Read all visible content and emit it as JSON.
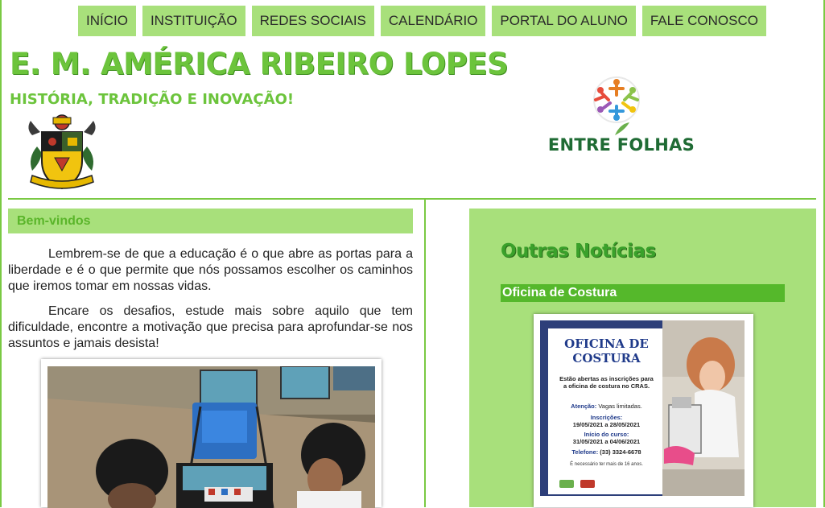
{
  "nav": {
    "items": [
      {
        "label": "INÍCIO"
      },
      {
        "label": "INSTITUIÇÃO"
      },
      {
        "label": "REDES SOCIAIS"
      },
      {
        "label": "CALENDÁRIO"
      },
      {
        "label": "PORTAL DO ALUNO"
      },
      {
        "label": "FALE CONOSCO"
      }
    ]
  },
  "header": {
    "title": "E. M. AMÉRICA RIBEIRO LOPES",
    "subtitle": "HISTÓRIA, TRADIÇÃO E INOVAÇÃO!",
    "partner_logo_text": "ENTRE FOLHAS"
  },
  "welcome": {
    "heading": "Bem-vindos",
    "paragraphs": [
      "Lembrem-se de que a educação é o que abre as portas para a liberdade e é o que permite que nós possamos escolher os caminhos que iremos tomar em nossas vidas.",
      "Encare os desafios, estude mais sobre aquilo que tem dificuldade, encontre a motivação que precisa para aprofundar-se nos assuntos e jamais desista!"
    ]
  },
  "news": {
    "heading": "Outras Notícias",
    "items": [
      {
        "title": "Oficina de Costura"
      }
    ],
    "flyer": {
      "title_line1": "OFICINA DE",
      "title_line2": "COSTURA",
      "intro": "Estão abertas as inscrições para a oficina de costura no CRAS.",
      "attention_label": "Atenção:",
      "attention_text": "Vagas limitadas.",
      "signup_label": "Inscrições:",
      "signup_dates": "19/05/2021 a 28/05/2021",
      "start_label": "Início do curso:",
      "start_dates": "31/05/2021 a 04/06/2021",
      "phone_label": "Telefone:",
      "phone": "(33) 3324-6678",
      "footnote": "É necessário ter mais de 16 anos."
    }
  },
  "colors": {
    "accent_green": "#a8e07b",
    "title_green": "#6cc43c",
    "news_bar_green": "#55b82b",
    "flyer_navy": "#1f3a8a"
  },
  "icons": {
    "crest": "school-crest-icon",
    "partner_logo": "entre-folhas-logo-icon"
  }
}
